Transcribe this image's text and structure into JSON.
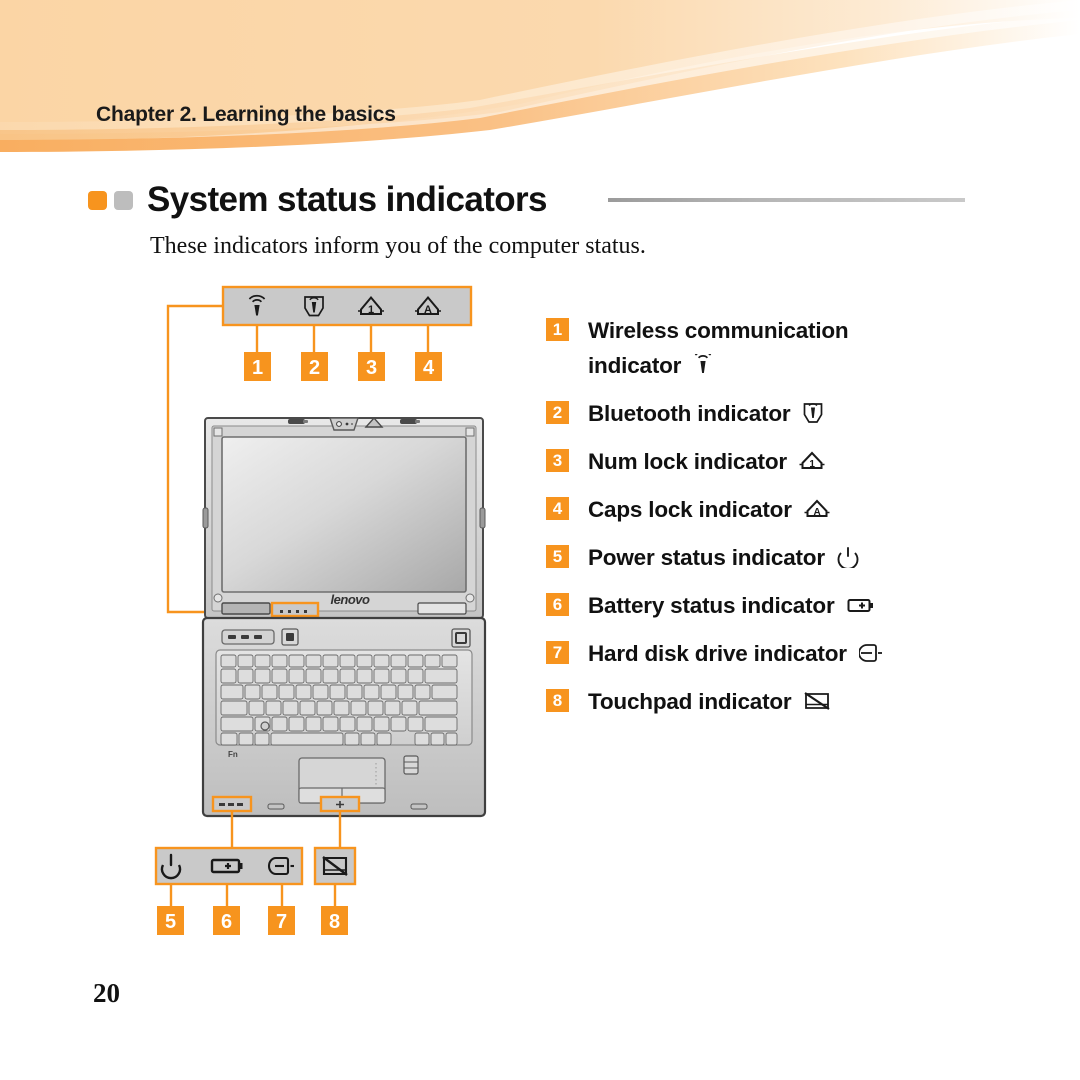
{
  "header": {
    "chapter": "Chapter 2. Learning the basics",
    "band_color_light": "#FBD9AE",
    "band_color_mid": "#F9C68C",
    "band_color_dark": "#F8A95B"
  },
  "section": {
    "title": "System status indicators",
    "bullet_color_1": "#F7941E",
    "bullet_color_2": "#BDBDBD",
    "rule_color": "#A9A9A9"
  },
  "intro": "These indicators inform you of the computer status.",
  "accent_color": "#F7941E",
  "indicator_panel_color": "#C9C9C9",
  "figure": {
    "brand_logo": "lenovo",
    "top_panel_icons": [
      {
        "number": "1",
        "icon": "wireless-antenna-icon"
      },
      {
        "number": "2",
        "icon": "bluetooth-antenna-icon"
      },
      {
        "number": "3",
        "icon": "num-lock-icon"
      },
      {
        "number": "4",
        "icon": "caps-lock-icon"
      }
    ],
    "bottom_panel_icons": [
      {
        "number": "5",
        "icon": "power-icon"
      },
      {
        "number": "6",
        "icon": "battery-icon"
      },
      {
        "number": "7",
        "icon": "hard-disk-icon"
      },
      {
        "number": "8",
        "icon": "touchpad-icon"
      }
    ]
  },
  "list": {
    "items": [
      {
        "number": "1",
        "label": "Wireless communication",
        "label2": "indicator",
        "icon": "wireless-antenna-icon"
      },
      {
        "number": "2",
        "label": "Bluetooth indicator",
        "icon": "bluetooth-antenna-icon"
      },
      {
        "number": "3",
        "label": "Num lock indicator",
        "icon": "num-lock-icon"
      },
      {
        "number": "4",
        "label": "Caps lock indicator",
        "icon": "caps-lock-icon"
      },
      {
        "number": "5",
        "label": "Power status indicator",
        "icon": "power-icon"
      },
      {
        "number": "6",
        "label": "Battery status indicator",
        "icon": "battery-icon"
      },
      {
        "number": "7",
        "label": "Hard disk drive indicator",
        "icon": "hard-disk-icon"
      },
      {
        "number": "8",
        "label": "Touchpad indicator",
        "icon": "touchpad-icon"
      }
    ]
  },
  "page_number": "20"
}
